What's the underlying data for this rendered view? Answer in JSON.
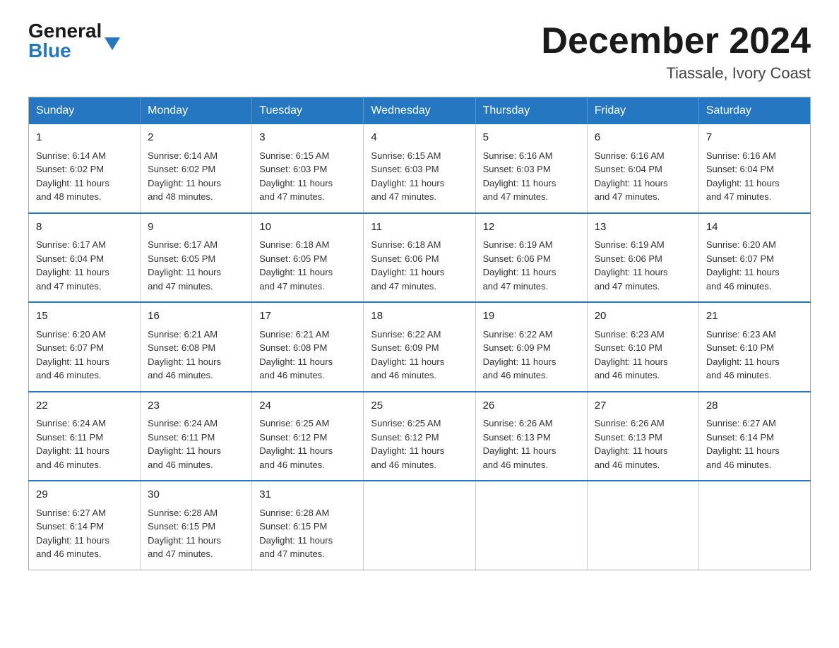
{
  "header": {
    "logo_general": "General",
    "logo_blue": "Blue",
    "month_title": "December 2024",
    "location": "Tiassale, Ivory Coast"
  },
  "weekdays": [
    "Sunday",
    "Monday",
    "Tuesday",
    "Wednesday",
    "Thursday",
    "Friday",
    "Saturday"
  ],
  "weeks": [
    [
      {
        "day": "1",
        "sunrise": "6:14 AM",
        "sunset": "6:02 PM",
        "daylight": "11 hours and 48 minutes."
      },
      {
        "day": "2",
        "sunrise": "6:14 AM",
        "sunset": "6:02 PM",
        "daylight": "11 hours and 48 minutes."
      },
      {
        "day": "3",
        "sunrise": "6:15 AM",
        "sunset": "6:03 PM",
        "daylight": "11 hours and 47 minutes."
      },
      {
        "day": "4",
        "sunrise": "6:15 AM",
        "sunset": "6:03 PM",
        "daylight": "11 hours and 47 minutes."
      },
      {
        "day": "5",
        "sunrise": "6:16 AM",
        "sunset": "6:03 PM",
        "daylight": "11 hours and 47 minutes."
      },
      {
        "day": "6",
        "sunrise": "6:16 AM",
        "sunset": "6:04 PM",
        "daylight": "11 hours and 47 minutes."
      },
      {
        "day": "7",
        "sunrise": "6:16 AM",
        "sunset": "6:04 PM",
        "daylight": "11 hours and 47 minutes."
      }
    ],
    [
      {
        "day": "8",
        "sunrise": "6:17 AM",
        "sunset": "6:04 PM",
        "daylight": "11 hours and 47 minutes."
      },
      {
        "day": "9",
        "sunrise": "6:17 AM",
        "sunset": "6:05 PM",
        "daylight": "11 hours and 47 minutes."
      },
      {
        "day": "10",
        "sunrise": "6:18 AM",
        "sunset": "6:05 PM",
        "daylight": "11 hours and 47 minutes."
      },
      {
        "day": "11",
        "sunrise": "6:18 AM",
        "sunset": "6:06 PM",
        "daylight": "11 hours and 47 minutes."
      },
      {
        "day": "12",
        "sunrise": "6:19 AM",
        "sunset": "6:06 PM",
        "daylight": "11 hours and 47 minutes."
      },
      {
        "day": "13",
        "sunrise": "6:19 AM",
        "sunset": "6:06 PM",
        "daylight": "11 hours and 47 minutes."
      },
      {
        "day": "14",
        "sunrise": "6:20 AM",
        "sunset": "6:07 PM",
        "daylight": "11 hours and 46 minutes."
      }
    ],
    [
      {
        "day": "15",
        "sunrise": "6:20 AM",
        "sunset": "6:07 PM",
        "daylight": "11 hours and 46 minutes."
      },
      {
        "day": "16",
        "sunrise": "6:21 AM",
        "sunset": "6:08 PM",
        "daylight": "11 hours and 46 minutes."
      },
      {
        "day": "17",
        "sunrise": "6:21 AM",
        "sunset": "6:08 PM",
        "daylight": "11 hours and 46 minutes."
      },
      {
        "day": "18",
        "sunrise": "6:22 AM",
        "sunset": "6:09 PM",
        "daylight": "11 hours and 46 minutes."
      },
      {
        "day": "19",
        "sunrise": "6:22 AM",
        "sunset": "6:09 PM",
        "daylight": "11 hours and 46 minutes."
      },
      {
        "day": "20",
        "sunrise": "6:23 AM",
        "sunset": "6:10 PM",
        "daylight": "11 hours and 46 minutes."
      },
      {
        "day": "21",
        "sunrise": "6:23 AM",
        "sunset": "6:10 PM",
        "daylight": "11 hours and 46 minutes."
      }
    ],
    [
      {
        "day": "22",
        "sunrise": "6:24 AM",
        "sunset": "6:11 PM",
        "daylight": "11 hours and 46 minutes."
      },
      {
        "day": "23",
        "sunrise": "6:24 AM",
        "sunset": "6:11 PM",
        "daylight": "11 hours and 46 minutes."
      },
      {
        "day": "24",
        "sunrise": "6:25 AM",
        "sunset": "6:12 PM",
        "daylight": "11 hours and 46 minutes."
      },
      {
        "day": "25",
        "sunrise": "6:25 AM",
        "sunset": "6:12 PM",
        "daylight": "11 hours and 46 minutes."
      },
      {
        "day": "26",
        "sunrise": "6:26 AM",
        "sunset": "6:13 PM",
        "daylight": "11 hours and 46 minutes."
      },
      {
        "day": "27",
        "sunrise": "6:26 AM",
        "sunset": "6:13 PM",
        "daylight": "11 hours and 46 minutes."
      },
      {
        "day": "28",
        "sunrise": "6:27 AM",
        "sunset": "6:14 PM",
        "daylight": "11 hours and 46 minutes."
      }
    ],
    [
      {
        "day": "29",
        "sunrise": "6:27 AM",
        "sunset": "6:14 PM",
        "daylight": "11 hours and 46 minutes."
      },
      {
        "day": "30",
        "sunrise": "6:28 AM",
        "sunset": "6:15 PM",
        "daylight": "11 hours and 47 minutes."
      },
      {
        "day": "31",
        "sunrise": "6:28 AM",
        "sunset": "6:15 PM",
        "daylight": "11 hours and 47 minutes."
      },
      null,
      null,
      null,
      null
    ]
  ],
  "labels": {
    "sunrise": "Sunrise:",
    "sunset": "Sunset:",
    "daylight": "Daylight:"
  }
}
